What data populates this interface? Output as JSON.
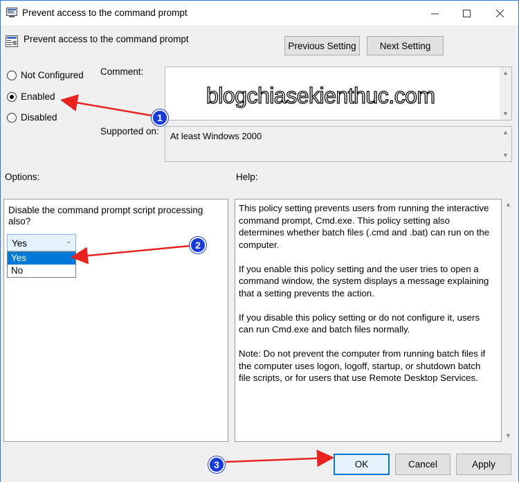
{
  "window": {
    "title": "Prevent access to the command prompt",
    "controls": [
      "minimize-icon",
      "maximize-icon",
      "close-icon"
    ]
  },
  "header": {
    "policy_name": "Prevent access to the command prompt",
    "previous_label": "Previous Setting",
    "next_label": "Next Setting"
  },
  "state": {
    "options": [
      {
        "label": "Not Configured",
        "selected": false
      },
      {
        "label": "Enabled",
        "selected": true
      },
      {
        "label": "Disabled",
        "selected": false
      }
    ]
  },
  "comment": {
    "label": "Comment:",
    "value": ""
  },
  "supported": {
    "label": "Supported on:",
    "value": "At least Windows 2000"
  },
  "watermark": "blogchiasekienthuc.com",
  "options_panel": {
    "title": "Options:",
    "question": "Disable the command prompt script processing also?",
    "select_value": "Yes",
    "dropdown_items": [
      "Yes",
      "No"
    ],
    "highlighted_item": "Yes"
  },
  "help_panel": {
    "title": "Help:",
    "paragraphs": [
      "This policy setting prevents users from running the interactive command prompt, Cmd.exe.  This policy setting also determines whether batch files (.cmd and .bat) can run on the computer.",
      "If you enable this policy setting and the user tries to open a command window, the system displays a message explaining that a setting prevents the action.",
      "If you disable this policy setting or do not configure it, users can run Cmd.exe and batch files normally.",
      "Note: Do not prevent the computer from running batch files if the computer uses logon, logoff, startup, or shutdown batch file scripts, or for users that use Remote Desktop Services."
    ]
  },
  "footer": {
    "ok_label": "OK",
    "cancel_label": "Cancel",
    "apply_label": "Apply"
  },
  "annotations": {
    "badges": [
      "1",
      "2",
      "3"
    ],
    "color": "#e8231f",
    "badge_color": "#1a3bd6"
  },
  "colors": {
    "accent": "#0078d7",
    "window_border": "#2b78d8",
    "dialog_bg": "#f0f0f0"
  }
}
